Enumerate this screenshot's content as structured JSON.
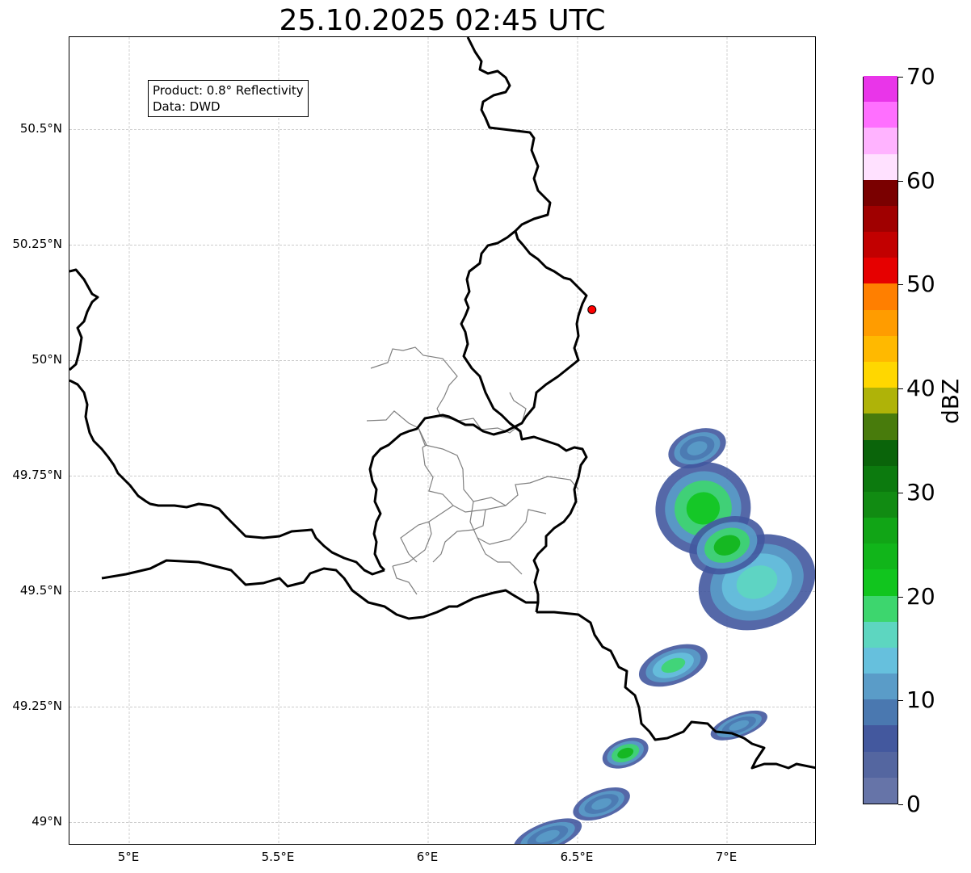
{
  "title": "25.10.2025 02:45 UTC",
  "info": {
    "product": "Product: 0.8° Reflectivity",
    "source": "Data: DWD"
  },
  "axes": {
    "lon_ticks": [
      {
        "value": 5.0,
        "label": "5°E"
      },
      {
        "value": 5.5,
        "label": "5.5°E"
      },
      {
        "value": 6.0,
        "label": "6°E"
      },
      {
        "value": 6.5,
        "label": "6.5°E"
      },
      {
        "value": 7.0,
        "label": "7°E"
      }
    ],
    "lat_ticks": [
      {
        "value": 50.5,
        "label": "50.5°N"
      },
      {
        "value": 50.25,
        "label": "50.25°N"
      },
      {
        "value": 50.0,
        "label": "50°N"
      },
      {
        "value": 49.75,
        "label": "49.75°N"
      },
      {
        "value": 49.5,
        "label": "49.5°N"
      },
      {
        "value": 49.25,
        "label": "49.25°N"
      },
      {
        "value": 49.0,
        "label": "49°N"
      }
    ],
    "lon_range": [
      4.8,
      7.3
    ],
    "lat_range": [
      48.95,
      50.7
    ],
    "grid": true
  },
  "radar_site": {
    "lon": 6.548,
    "lat": 50.11,
    "color": "#ff0000"
  },
  "colorbar": {
    "unit": "dBZ",
    "range": [
      0,
      70
    ],
    "tick_values": [
      0,
      10,
      20,
      30,
      40,
      50,
      60,
      70
    ],
    "tick_labels": [
      "0",
      "10",
      "20",
      "30",
      "40",
      "50",
      "60",
      "70"
    ],
    "colors": [
      "#6674a8",
      "#5466a0",
      "#43589e",
      "#4a78b0",
      "#5a9cc8",
      "#66c0dd",
      "#5dd6c0",
      "#3dd66e",
      "#11c51e",
      "#11b51a",
      "#11a516",
      "#118b12",
      "#0c7a0e",
      "#0a640a",
      "#487b0c",
      "#afb308",
      "#ffd700",
      "#ffb900",
      "#ff9c00",
      "#ff7f00",
      "#e60000",
      "#c20000",
      "#a00000",
      "#7a0000",
      "#ffe1ff",
      "#ffb3ff",
      "#ff6fff",
      "#e935e9"
    ]
  },
  "echoes": [
    {
      "lon": 6.92,
      "lat": 49.68,
      "rx": 0.16,
      "ry": 0.1,
      "dbz": 22
    },
    {
      "lon": 7.1,
      "lat": 49.52,
      "rx": 0.2,
      "ry": 0.1,
      "dbz": 16
    },
    {
      "lon": 7.0,
      "lat": 49.6,
      "rx": 0.13,
      "ry": 0.06,
      "dbz": 24
    },
    {
      "lon": 6.82,
      "lat": 49.34,
      "rx": 0.12,
      "ry": 0.04,
      "dbz": 18
    },
    {
      "lon": 6.66,
      "lat": 49.15,
      "rx": 0.08,
      "ry": 0.03,
      "dbz": 24
    },
    {
      "lon": 6.58,
      "lat": 49.04,
      "rx": 0.1,
      "ry": 0.03,
      "dbz": 12
    },
    {
      "lon": 6.4,
      "lat": 48.97,
      "rx": 0.12,
      "ry": 0.03,
      "dbz": 12
    },
    {
      "lon": 7.04,
      "lat": 49.21,
      "rx": 0.1,
      "ry": 0.025,
      "dbz": 10
    },
    {
      "lon": 6.9,
      "lat": 49.81,
      "rx": 0.1,
      "ry": 0.04,
      "dbz": 12
    }
  ]
}
